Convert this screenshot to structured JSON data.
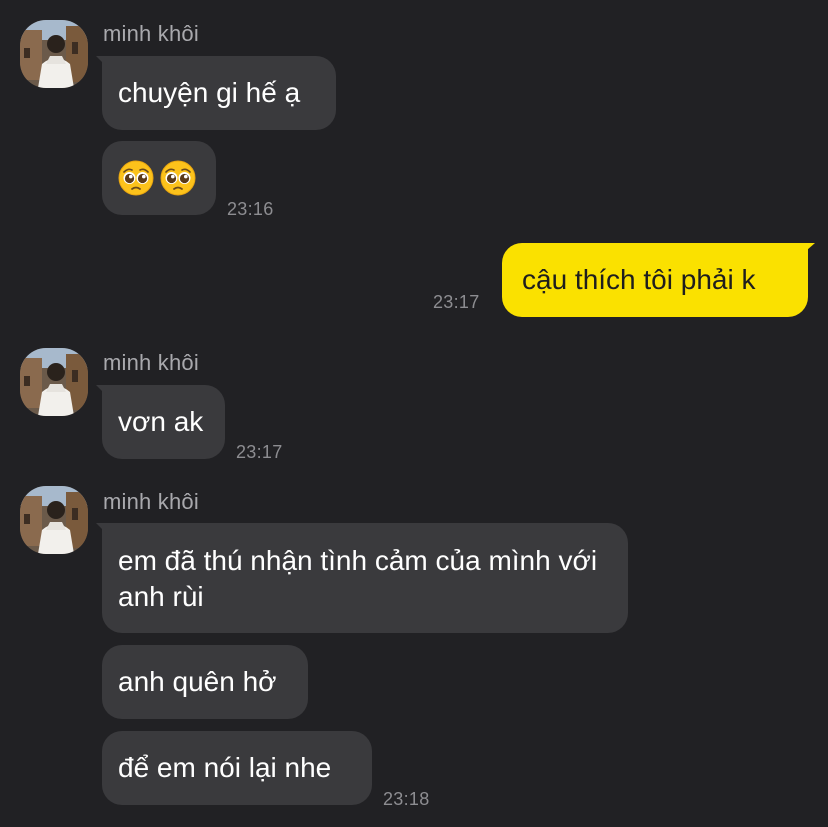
{
  "messages": {
    "m1": {
      "sender": "minh khôi",
      "text1": "chuyện gi hế ạ",
      "emoji_name": "pleading-face-emoji",
      "time": "23:16"
    },
    "m2": {
      "text": "cậu thích tôi phải k",
      "time": "23:17"
    },
    "m3": {
      "sender": "minh khôi",
      "text": "vơn ak",
      "time": "23:17"
    },
    "m4": {
      "sender": "minh khôi",
      "text1": "em đã thú nhận tình cảm của mình với anh rùi",
      "text2": "anh quên hở",
      "text3": "để em nói lại nhe",
      "time": "23:18"
    }
  },
  "colors": {
    "background": "#212124",
    "incoming_bubble": "#3a3a3d",
    "outgoing_bubble": "#fae100",
    "sender_name": "#a9a9ad",
    "timestamp": "#8d8d91"
  }
}
